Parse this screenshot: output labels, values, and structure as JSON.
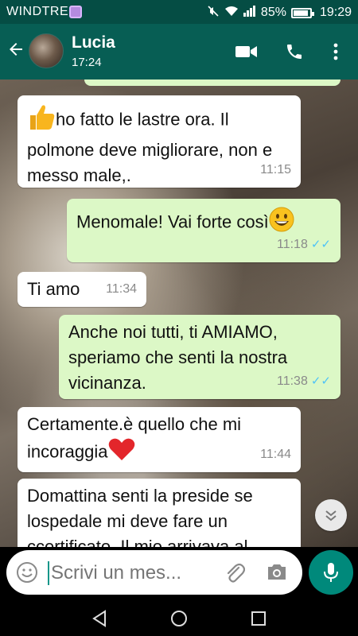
{
  "status_bar": {
    "carrier": "WINDTRE",
    "battery": "85%",
    "time": "19:29"
  },
  "header": {
    "contact_name": "Lucia",
    "last_seen": "17:24"
  },
  "messages": [
    {
      "direction": "incoming",
      "emoji": "thumbs-up",
      "text": "ho fatto le lastre ora. Il polmone deve migliorare, non e messo male,.",
      "time": "11:15"
    },
    {
      "direction": "outgoing",
      "text": "Menomale! Vai forte così",
      "emoji": "grinning-face",
      "time": "11:18",
      "status": "read"
    },
    {
      "direction": "incoming",
      "text": "Ti amo",
      "time": "11:34"
    },
    {
      "direction": "outgoing",
      "text": "Anche noi tutti, ti AMIAMO, speriamo che senti la nostra vicinanza.",
      "time": "11:38",
      "status": "read"
    },
    {
      "direction": "incoming",
      "text": "Certamente.è quello che mi incoraggia",
      "emoji": "red-heart",
      "time": "11:44"
    },
    {
      "direction": "incoming",
      "text": "Domattina senti la preside se lospedale mi deve fare un ccertificato. Il mio arrivava al"
    }
  ],
  "composer": {
    "placeholder": "Scrivi un mes..."
  },
  "colors": {
    "header": "#075e54",
    "status_bar": "#054d44",
    "incoming_bubble": "#ffffff",
    "outgoing_bubble": "#dcf8c6",
    "accent": "#00897b",
    "read_ticks": "#4fc3f7"
  },
  "icons": [
    "back-arrow-icon",
    "video-call-icon",
    "phone-icon",
    "more-vert-icon",
    "emoji-icon",
    "attach-icon",
    "camera-icon",
    "mic-icon",
    "scroll-down-icon",
    "nav-back-icon",
    "nav-home-icon",
    "nav-recents-icon"
  ]
}
